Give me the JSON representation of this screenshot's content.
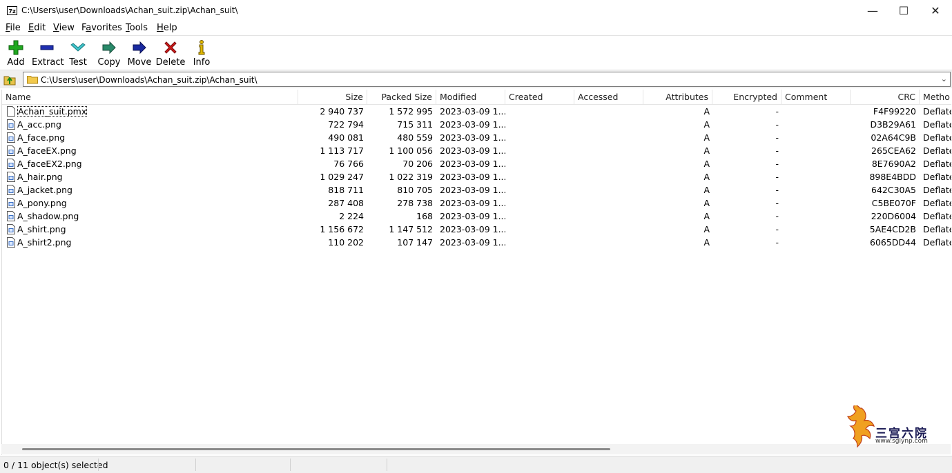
{
  "window": {
    "app_icon": "7z",
    "title": "C:\\Users\\user\\Downloads\\Achan_suit.zip\\Achan_suit\\",
    "controls": {
      "minimize": "—",
      "maximize": "☐",
      "close": "✕"
    }
  },
  "menu": {
    "items": [
      {
        "label": "File",
        "accel": "F",
        "rest": "ile"
      },
      {
        "label": "Edit",
        "accel": "E",
        "rest": "dit"
      },
      {
        "label": "View",
        "accel": "V",
        "rest": "iew"
      },
      {
        "label": "Favorites",
        "accel": "a",
        "pre": "F",
        "rest": "vorites"
      },
      {
        "label": "Tools",
        "accel": "T",
        "rest": "ools"
      },
      {
        "label": "Help",
        "accel": "H",
        "rest": "elp"
      }
    ]
  },
  "toolbar": {
    "add": "Add",
    "extract": "Extract",
    "test": "Test",
    "copy": "Copy",
    "move": "Move",
    "delete": "Delete",
    "info": "Info"
  },
  "address": {
    "path": "C:\\Users\\user\\Downloads\\Achan_suit.zip\\Achan_suit\\"
  },
  "columns": {
    "name": "Name",
    "size": "Size",
    "packed": "Packed Size",
    "modified": "Modified",
    "created": "Created",
    "accessed": "Accessed",
    "attributes": "Attributes",
    "encrypted": "Encrypted",
    "comment": "Comment",
    "crc": "CRC",
    "method": "Metho"
  },
  "files": [
    {
      "name": "Achan_suit.pmx",
      "size": "2 940 737",
      "packed": "1 572 995",
      "modified": "2023-03-09 1...",
      "attr": "A",
      "enc": "-",
      "crc": "F4F99220",
      "method": "Deflate"
    },
    {
      "name": "A_acc.png",
      "size": "722 794",
      "packed": "715 311",
      "modified": "2023-03-09 1...",
      "attr": "A",
      "enc": "-",
      "crc": "D3B29A61",
      "method": "Deflate"
    },
    {
      "name": "A_face.png",
      "size": "490 081",
      "packed": "480 559",
      "modified": "2023-03-09 1...",
      "attr": "A",
      "enc": "-",
      "crc": "02A64C9B",
      "method": "Deflate"
    },
    {
      "name": "A_faceEX.png",
      "size": "1 113 717",
      "packed": "1 100 056",
      "modified": "2023-03-09 1...",
      "attr": "A",
      "enc": "-",
      "crc": "265CEA62",
      "method": "Deflate"
    },
    {
      "name": "A_faceEX2.png",
      "size": "76 766",
      "packed": "70 206",
      "modified": "2023-03-09 1...",
      "attr": "A",
      "enc": "-",
      "crc": "8E7690A2",
      "method": "Deflate"
    },
    {
      "name": "A_hair.png",
      "size": "1 029 247",
      "packed": "1 022 319",
      "modified": "2023-03-09 1...",
      "attr": "A",
      "enc": "-",
      "crc": "898E4BDD",
      "method": "Deflate"
    },
    {
      "name": "A_jacket.png",
      "size": "818 711",
      "packed": "810 705",
      "modified": "2023-03-09 1...",
      "attr": "A",
      "enc": "-",
      "crc": "642C30A5",
      "method": "Deflate"
    },
    {
      "name": "A_pony.png",
      "size": "287 408",
      "packed": "278 738",
      "modified": "2023-03-09 1...",
      "attr": "A",
      "enc": "-",
      "crc": "C5BE070F",
      "method": "Deflate"
    },
    {
      "name": "A_shadow.png",
      "size": "2 224",
      "packed": "168",
      "modified": "2023-03-09 1...",
      "attr": "A",
      "enc": "-",
      "crc": "220D6004",
      "method": "Deflate"
    },
    {
      "name": "A_shirt.png",
      "size": "1 156 672",
      "packed": "1 147 512",
      "modified": "2023-03-09 1...",
      "attr": "A",
      "enc": "-",
      "crc": "5AE4CD2B",
      "method": "Deflate"
    },
    {
      "name": "A_shirt2.png",
      "size": "110 202",
      "packed": "107 147",
      "modified": "2023-03-09 1...",
      "attr": "A",
      "enc": "-",
      "crc": "6065DD44",
      "method": "Deflate"
    }
  ],
  "status": {
    "selection": "0 / 11 object(s) selected"
  },
  "watermark": {
    "text": "三宫六院",
    "url": "www.sglynp.com"
  },
  "colors": {
    "add": "#1fa81f",
    "extract": "#1f2fb0",
    "test": "#3fc3c9",
    "copy": "#2a8a6a",
    "move": "#1a2aa0",
    "delete": "#d01a1a",
    "info": "#c9a400"
  }
}
